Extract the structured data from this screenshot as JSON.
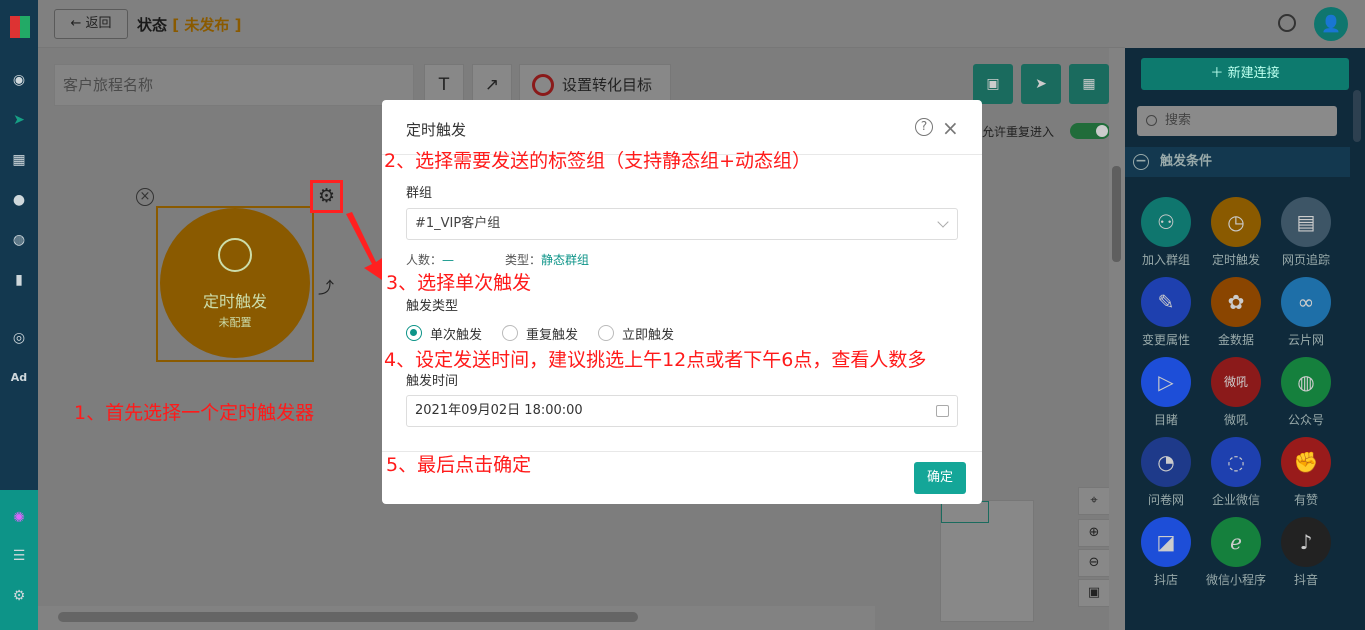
{
  "header": {
    "back_label": "返回",
    "title": "状态",
    "status_open": "[",
    "status": "未发布",
    "status_close": "]",
    "avatar_icon": "user-icon"
  },
  "toolbar": {
    "journey_name_placeholder": "客户旅程名称",
    "text_tool": "T",
    "arrow_tool": "↗",
    "goal_label": "设置转化目标",
    "allow_reentry_label": "允许重复进入",
    "allow_reentry": true
  },
  "canvas_node": {
    "title": "定时触发",
    "subtitle": "未配置"
  },
  "right_panel": {
    "new_connection_label": "新建连接",
    "search_placeholder": "搜索",
    "section_title": "触发条件",
    "tiles": [
      {
        "label": "加入群组",
        "icon": "add-user-icon",
        "color": "#0f766e"
      },
      {
        "label": "定时触发",
        "icon": "clock-icon",
        "color": "#8a5a00"
      },
      {
        "label": "网页追踪",
        "icon": "browser-icon",
        "color": "#3d5566"
      },
      {
        "label": "变更属性",
        "icon": "edit-icon",
        "color": "#1e40af"
      },
      {
        "label": "金数据",
        "icon": "jinshuju-icon",
        "color": "#8a4500"
      },
      {
        "label": "云片网",
        "icon": "yunpian-icon",
        "color": "#1e6fa8"
      },
      {
        "label": "目睹",
        "icon": "play-icon",
        "color": "#1d4ed8"
      },
      {
        "label": "微吼",
        "icon": "weihou-icon",
        "color": "#8b1a1a",
        "glyph": "微吼"
      },
      {
        "label": "公众号",
        "icon": "wechat-icon",
        "color": "#15803d"
      },
      {
        "label": "问卷网",
        "icon": "wenjuan-icon",
        "color": "#1e3a8a"
      },
      {
        "label": "企业微信",
        "icon": "wecom-icon",
        "color": "#1e40af"
      },
      {
        "label": "有赞",
        "icon": "thumb-up-icon",
        "color": "#991b1b"
      },
      {
        "label": "抖店",
        "icon": "doudian-icon",
        "color": "#1d4ed8"
      },
      {
        "label": "微信小程序",
        "icon": "miniprogram-icon",
        "color": "#15803d"
      },
      {
        "label": "抖音",
        "icon": "tiktok-icon",
        "color": "#222222"
      }
    ]
  },
  "modal": {
    "title": "定时触发",
    "group_label": "群组",
    "group_value": "#1_VIP客户组",
    "count_label": "人数：",
    "count_value": "—",
    "type_label": "类型：",
    "type_value": "静态群组",
    "trigger_type_label": "触发类型",
    "trigger_options": [
      "单次触发",
      "重复触发",
      "立即触发"
    ],
    "trigger_selected": 0,
    "trigger_time_label": "触发时间",
    "trigger_time_value": "2021年09月02日 18:00:00",
    "confirm_label": "确定"
  },
  "annotations": {
    "a1": "1、首先选择一个定时触发器",
    "a2": "2、选择需要发送的标签组（支持静态组+动态组）",
    "a3": "3、选择单次触发",
    "a4": "4、设定发送时间，建议挑选上午12点或者下午6点，查看人数多",
    "a5": "5、最后点击确定"
  },
  "colors": {
    "accent": "#14a698",
    "annotation": "#ff1a1a",
    "node": "#8a5a00"
  }
}
